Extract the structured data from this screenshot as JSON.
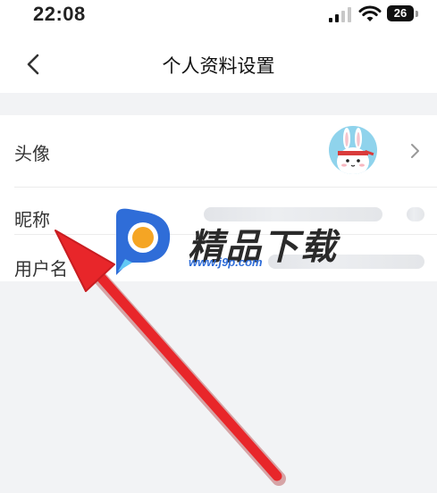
{
  "status_bar": {
    "time": "22:08",
    "battery": "26",
    "icons": [
      "cellular-signal-icon",
      "wifi-icon",
      "battery-icon"
    ]
  },
  "nav": {
    "title": "个人资料设置",
    "back_icon": "chevron-left-icon"
  },
  "settings": {
    "rows": [
      {
        "label": "头像",
        "value_type": "avatar-image",
        "icon": "chevron-right-icon"
      },
      {
        "label": "昵称",
        "value_type": "blurred-text"
      },
      {
        "label": "用户名",
        "value_type": "blurred-text"
      }
    ]
  },
  "watermark": {
    "title": "精品下载",
    "url": "www.j9p.com",
    "logo_icon": "j9p-logo-icon"
  },
  "annotation": {
    "type": "red-arrow",
    "color": "#e8262a",
    "points_to": "昵称"
  },
  "colors": {
    "page_background": "#f2f3f5",
    "card_background": "#ffffff",
    "text": "#333333",
    "avatar_background": "#8fd3ec",
    "watermark_blue": "#2f6dd8",
    "watermark_orange": "#f5a524"
  }
}
